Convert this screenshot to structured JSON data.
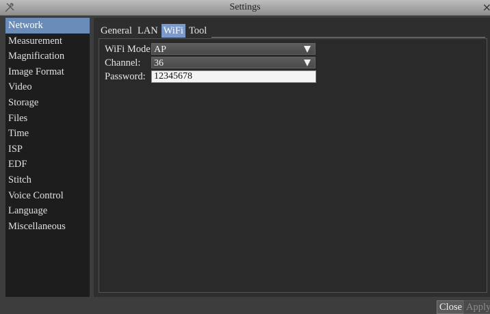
{
  "window": {
    "title": "Settings",
    "close_glyph": "×",
    "app_icon": "tools-icon"
  },
  "sidebar": {
    "items": [
      {
        "label": "Network",
        "active": true
      },
      {
        "label": "Measurement"
      },
      {
        "label": "Magnification"
      },
      {
        "label": "Image Format"
      },
      {
        "label": "Video"
      },
      {
        "label": "Storage"
      },
      {
        "label": "Files"
      },
      {
        "label": "Time"
      },
      {
        "label": "ISP"
      },
      {
        "label": "EDF"
      },
      {
        "label": "Stitch"
      },
      {
        "label": "Voice Control"
      },
      {
        "label": "Language"
      },
      {
        "label": "Miscellaneous"
      }
    ]
  },
  "tabs": [
    {
      "label": "General"
    },
    {
      "label": "LAN"
    },
    {
      "label": "WiFi",
      "active": true
    },
    {
      "label": "Tool"
    }
  ],
  "wifi": {
    "mode_label": "WiFi Mode:",
    "mode_value": "AP",
    "channel_label": "Channel:",
    "channel_value": "36",
    "password_label": "Password:",
    "password_value": "12345678"
  },
  "footer": {
    "close_label": "Close",
    "apply_label": "Apply"
  },
  "colors": {
    "accent": "#6a8cb8",
    "tab_active": "#7a9acb"
  }
}
